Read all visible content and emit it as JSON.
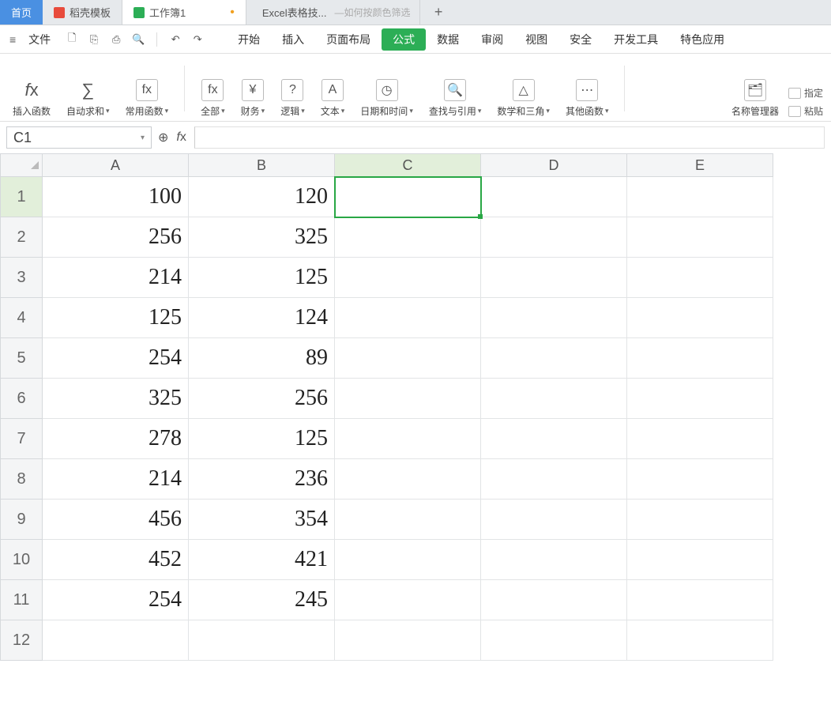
{
  "tabs": {
    "home": "首页",
    "t1": "稻壳模板",
    "t2": "工作簿1",
    "t3_prefix": "Excel表格技...",
    "t3_suffix": "—如何按颜色筛选",
    "add": "+"
  },
  "menu": {
    "file": "文件",
    "items": [
      "开始",
      "插入",
      "页面布局",
      "公式",
      "数据",
      "审阅",
      "视图",
      "安全",
      "开发工具",
      "特色应用"
    ],
    "active_index": 3
  },
  "ribbon": {
    "g0": "插入函数",
    "g1": "自动求和",
    "g2": "常用函数",
    "g3": "全部",
    "g4": "财务",
    "g5": "逻辑",
    "g6": "文本",
    "g7": "日期和时间",
    "g8": "查找与引用",
    "g9": "数学和三角",
    "g10": "其他函数",
    "g11": "名称管理器",
    "m0": "指定",
    "m1": "粘贴"
  },
  "namebox": {
    "value": "C1"
  },
  "columns": [
    "A",
    "B",
    "C",
    "D",
    "E"
  ],
  "rowCount": 12,
  "selected_cell": {
    "row": 1,
    "col": "C"
  },
  "cells": {
    "A": [
      "100",
      "256",
      "214",
      "125",
      "254",
      "325",
      "278",
      "214",
      "456",
      "452",
      "254",
      ""
    ],
    "B": [
      "120",
      "325",
      "125",
      "124",
      "89",
      "256",
      "125",
      "236",
      "354",
      "421",
      "245",
      ""
    ],
    "C": [
      "",
      "",
      "",
      "",
      "",
      "",
      "",
      "",
      "",
      "",
      "",
      ""
    ],
    "D": [
      "",
      "",
      "",
      "",
      "",
      "",
      "",
      "",
      "",
      "",
      "",
      ""
    ],
    "E": [
      "",
      "",
      "",
      "",
      "",
      "",
      "",
      "",
      "",
      "",
      "",
      ""
    ]
  }
}
